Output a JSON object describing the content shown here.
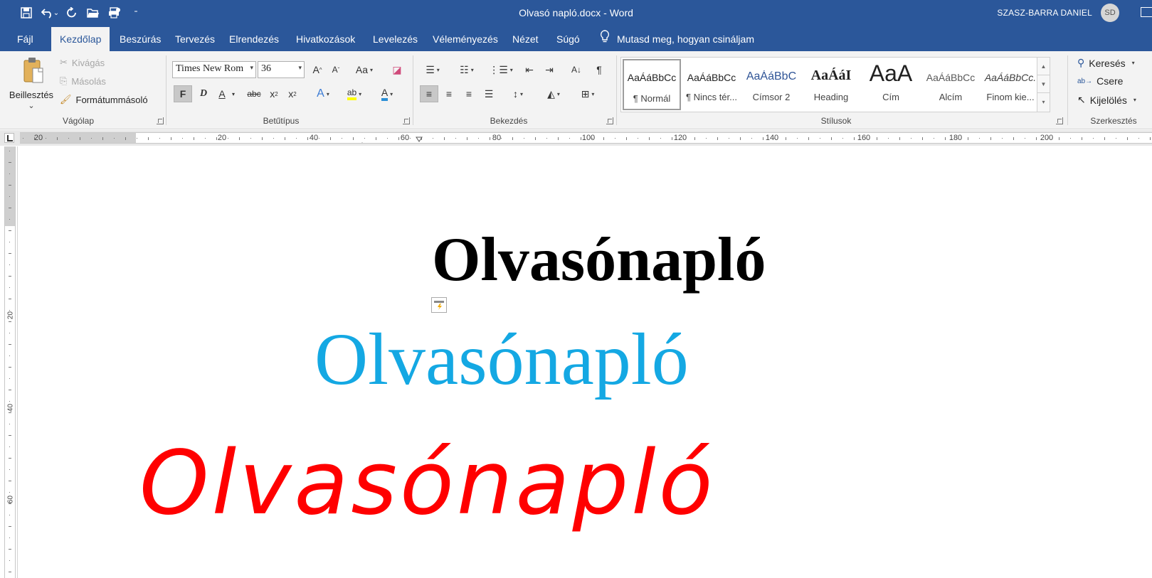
{
  "app": {
    "document_title": "Olvasó napló.docx  -  Word",
    "user_name": "SZASZ-BARRA DANIEL",
    "user_initials": "SD"
  },
  "tabs": [
    {
      "label": "Fájl"
    },
    {
      "label": "Kezdőlap",
      "active": true
    },
    {
      "label": "Beszúrás"
    },
    {
      "label": "Tervezés"
    },
    {
      "label": "Elrendezés"
    },
    {
      "label": "Hivatkozások"
    },
    {
      "label": "Levelezés"
    },
    {
      "label": "Véleményezés"
    },
    {
      "label": "Nézet"
    },
    {
      "label": "Súgó"
    }
  ],
  "tell_me": "Mutasd meg, hogyan csináljam",
  "clipboard": {
    "paste": "Beillesztés",
    "cut": "Kivágás",
    "copy": "Másolás",
    "format_painter": "Formátummásoló",
    "group_label": "Vágólap"
  },
  "font": {
    "name": "Times New Rom",
    "size": "36",
    "bold": "F",
    "italic": "D",
    "underline": "A",
    "strike": "abc",
    "case": "Aa",
    "group_label": "Betűtípus"
  },
  "paragraph": {
    "group_label": "Bekezdés"
  },
  "styles": {
    "group_label": "Stílusok",
    "items": [
      {
        "sample": "AaÁáBbCc",
        "name": "¶ Normál",
        "selected": true
      },
      {
        "sample": "AaÁáBbCc",
        "name": "¶ Nincs tér..."
      },
      {
        "sample": "AaÁáBbC",
        "name": "Címsor 2"
      },
      {
        "sample": "AaÁáI",
        "name": "Heading"
      },
      {
        "sample": "AaA",
        "name": "Cím"
      },
      {
        "sample": "AaÁáBbCc",
        "name": "Alcím"
      },
      {
        "sample": "AaÁáBbCc.",
        "name": "Finom kie..."
      }
    ]
  },
  "editing": {
    "find": "Keresés",
    "replace": "Csere",
    "select": "Kijelölés",
    "group_label": "Szerkesztés"
  },
  "ruler": {
    "labels": [
      "20",
      "20",
      "40",
      "60",
      "80",
      "100",
      "120",
      "140",
      "160",
      "180",
      "200"
    ],
    "vertical_labels": [
      "20",
      "40",
      "60"
    ]
  },
  "document": {
    "line1": "Olvasónapló",
    "line2": "Olvasónapló",
    "line3": "Olvasónapló",
    "colors": {
      "line1": "#000000",
      "line2": "#14a8e3",
      "line3": "#ff0000"
    }
  },
  "theme": {
    "accent": "#2b579a",
    "ribbon_bg": "#f3f3f3"
  }
}
